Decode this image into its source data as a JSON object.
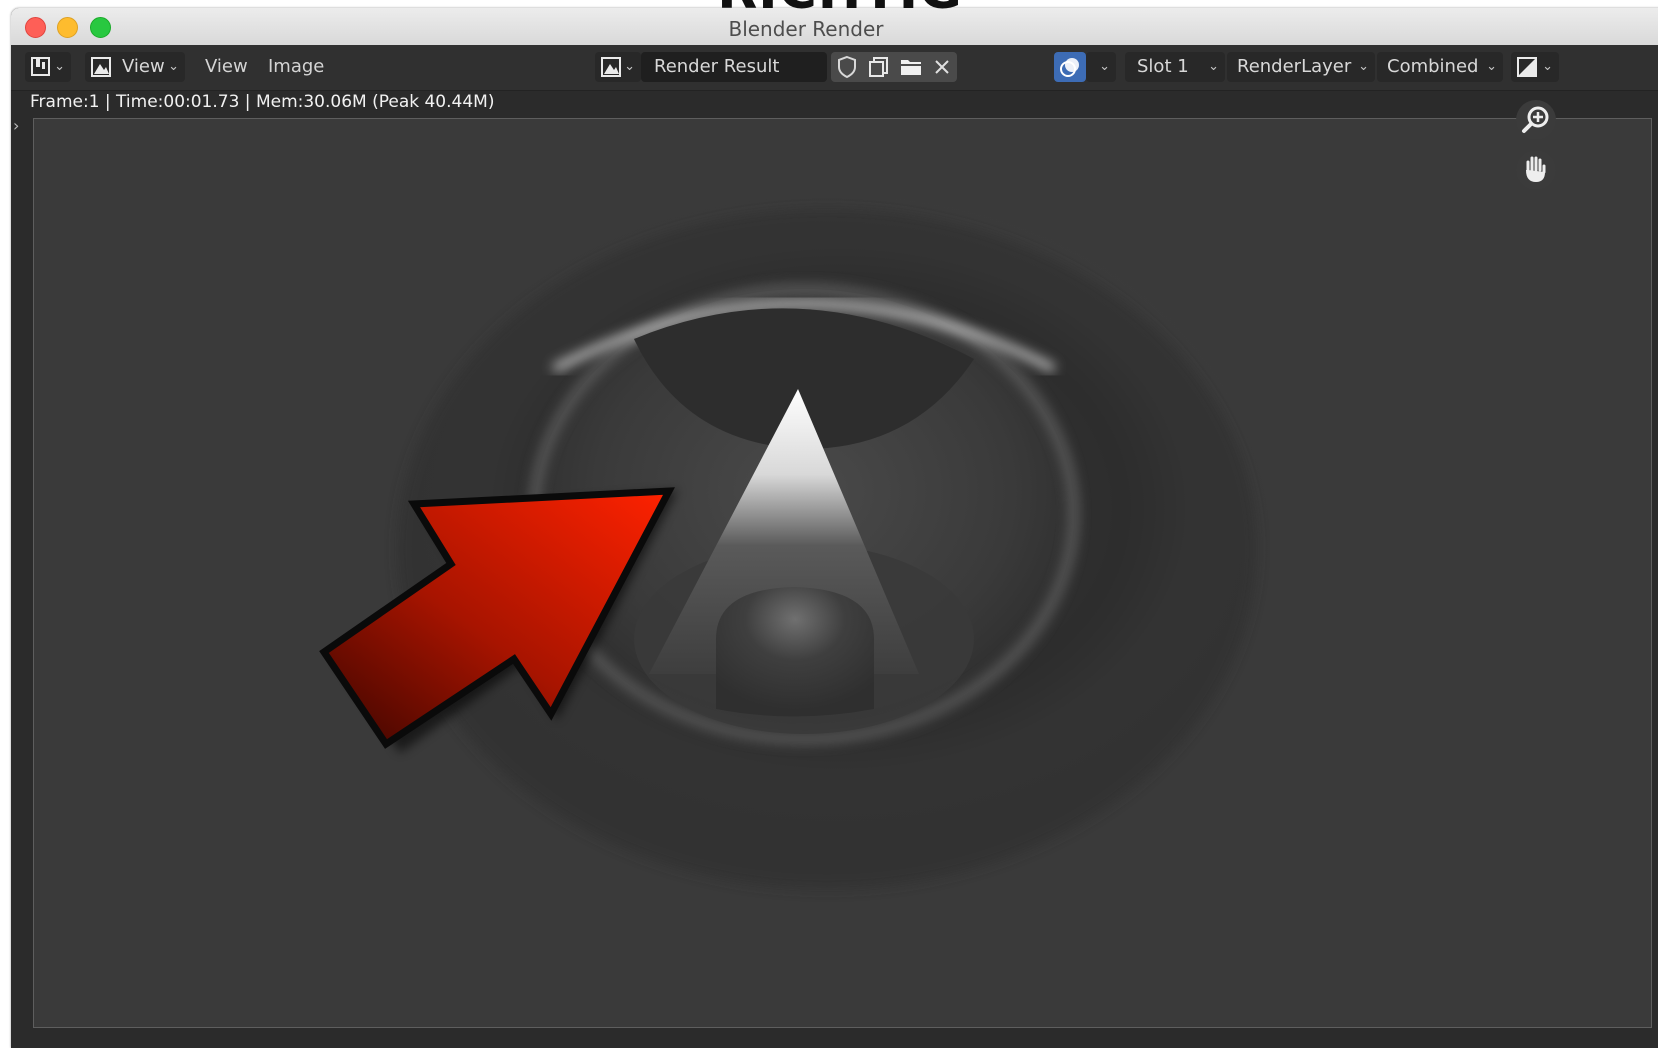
{
  "overlay_caption": "RICHTIG",
  "window": {
    "title": "Blender Render"
  },
  "header": {
    "editor_type_icon": "image-editor-icon",
    "view_mode_icon": "image-view-icon",
    "view_dropdown_label": "View",
    "menu_view": "View",
    "menu_image": "Image",
    "browse_image_icon": "image-browse-icon",
    "image_name": "Render Result",
    "fake_user_icon": "shield-icon",
    "new_image_icon": "duplicate-icon",
    "open_image_icon": "folder-icon",
    "unlink_icon": "close-icon",
    "overlay_icon": "overlay-icon",
    "slot_label": "Slot 1",
    "layer_label": "RenderLayer",
    "pass_label": "Combined",
    "display_channels_icon": "channels-icon"
  },
  "status_text": "Frame:1 | Time:00:01.73 | Mem:30.06M (Peak 40.44M)",
  "viewport_tools": {
    "zoom_icon": "zoom-in-icon",
    "pan_icon": "hand-icon"
  },
  "colors": {
    "arrow_light": "#ff2200",
    "arrow_dark": "#3a0500",
    "accent_blue": "#3d6cb5"
  }
}
